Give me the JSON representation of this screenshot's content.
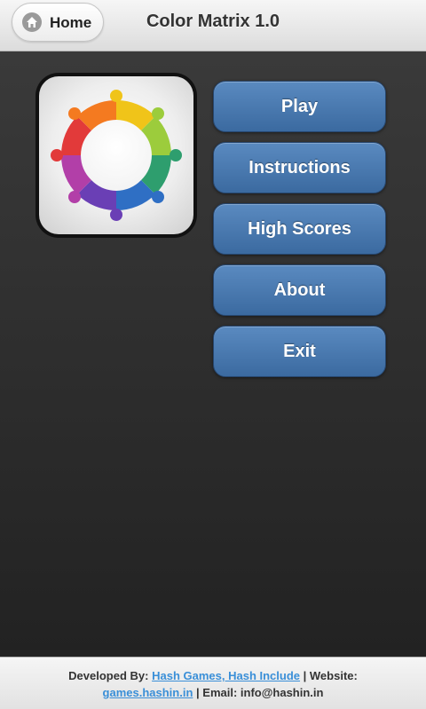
{
  "header": {
    "home_label": "Home",
    "title": "Color Matrix 1.0"
  },
  "menu": [
    {
      "label": "Play"
    },
    {
      "label": "Instructions"
    },
    {
      "label": "High Scores"
    },
    {
      "label": "About"
    },
    {
      "label": "Exit"
    }
  ],
  "footer": {
    "developed_by_label": "Developed By:",
    "developer_link": "Hash Games, Hash Include",
    "website_label": "| Website:",
    "website_link": "games.hashin.in",
    "email_text": "| Email: info@hashin.in"
  },
  "icons": {
    "home": "home-icon",
    "logo": "color-wheel-puzzle-icon"
  },
  "colors": {
    "button_top": "#5a8ac0",
    "button_bottom": "#3b6aa0",
    "background": "#2b2b2b",
    "link": "#3a8fd8"
  }
}
